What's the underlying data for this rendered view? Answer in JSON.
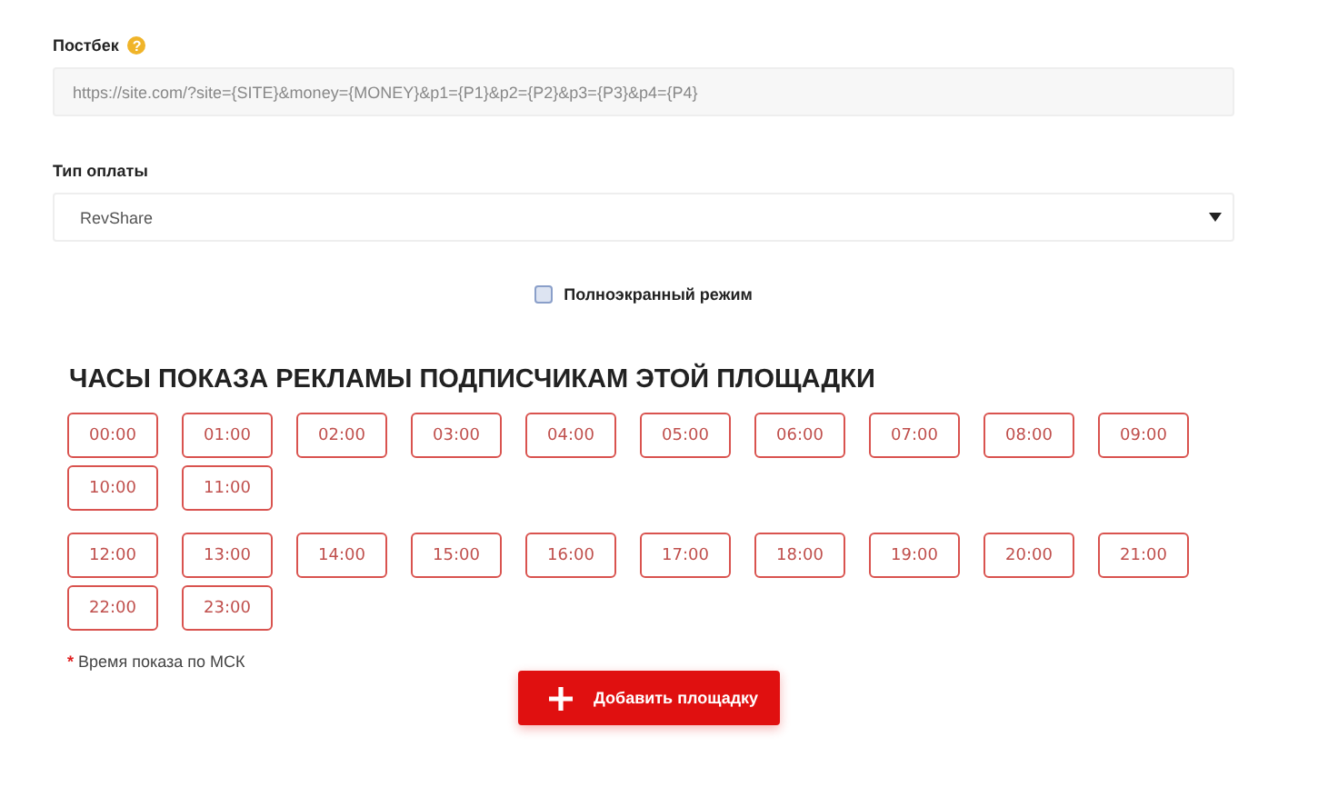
{
  "postback": {
    "label": "Постбек",
    "help_icon": "?",
    "value": "https://site.com/?site={SITE}&money={MONEY}&p1={P1}&p2={P2}&p3={P3}&p4={P4}"
  },
  "payment_type": {
    "label": "Тип оплаты",
    "value": "RevShare"
  },
  "fullscreen": {
    "label": "Полноэкранный режим",
    "checked": false
  },
  "hours_title": "ЧАСЫ ПОКАЗА РЕКЛАМЫ ПОДПИСЧИКАМ ЭТОЙ ПЛОЩАДКИ",
  "hour_groups": [
    [
      "00:00",
      "01:00",
      "02:00",
      "03:00",
      "04:00",
      "05:00",
      "06:00",
      "07:00",
      "08:00",
      "09:00",
      "10:00",
      "11:00"
    ],
    [
      "12:00",
      "13:00",
      "14:00",
      "15:00",
      "16:00",
      "17:00",
      "18:00",
      "19:00",
      "20:00",
      "21:00",
      "22:00",
      "23:00"
    ]
  ],
  "note": {
    "mark": "*",
    "text": "Время показа по МСК"
  },
  "add_button": {
    "label": "Добавить площадку"
  }
}
